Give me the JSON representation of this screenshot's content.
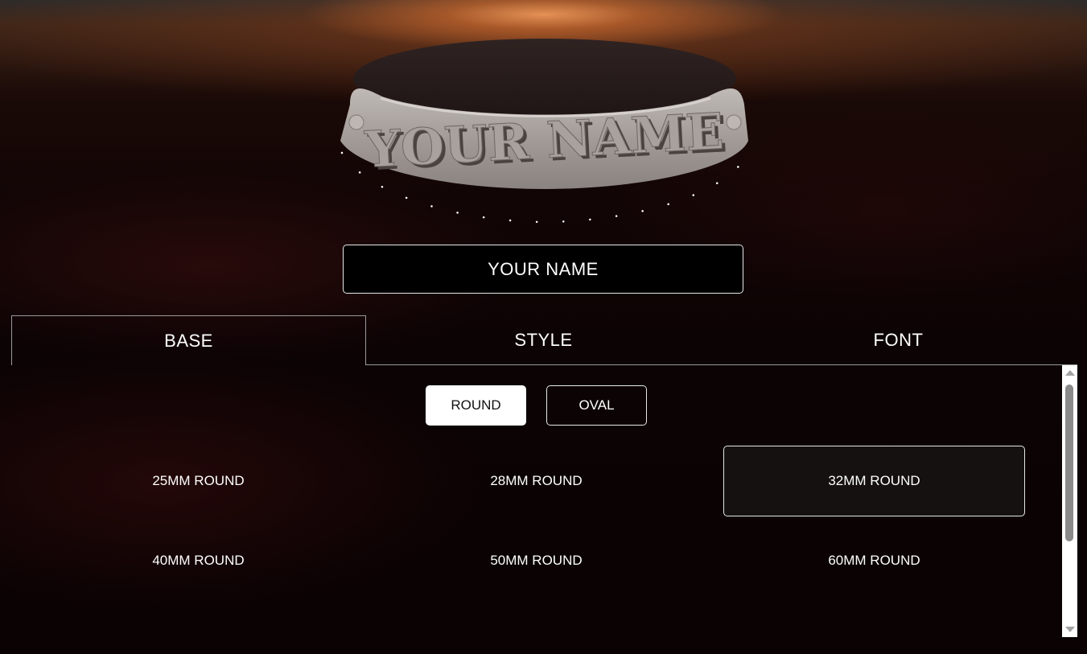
{
  "preview": {
    "plate_text": "YOUR NAME"
  },
  "name_input": {
    "value": "YOUR NAME"
  },
  "tabs": [
    {
      "label": "BASE",
      "active": true
    },
    {
      "label": "STYLE",
      "active": false
    },
    {
      "label": "FONT",
      "active": false
    }
  ],
  "base_panel": {
    "shape_options": [
      {
        "label": "ROUND",
        "selected": true
      },
      {
        "label": "OVAL",
        "selected": false
      }
    ],
    "sizes": [
      {
        "label": "25MM ROUND",
        "selected": false
      },
      {
        "label": "28MM ROUND",
        "selected": false
      },
      {
        "label": "32MM ROUND",
        "selected": true
      },
      {
        "label": "40MM ROUND",
        "selected": false
      },
      {
        "label": "50MM ROUND",
        "selected": false
      },
      {
        "label": "60MM ROUND",
        "selected": false
      }
    ]
  },
  "colors": {
    "background_glow": "#e0935a",
    "base_top": "#2a1c1c",
    "plate": "#a49d99",
    "selected_size_bg": "#141110",
    "active_shape_bg": "#ffffff"
  }
}
